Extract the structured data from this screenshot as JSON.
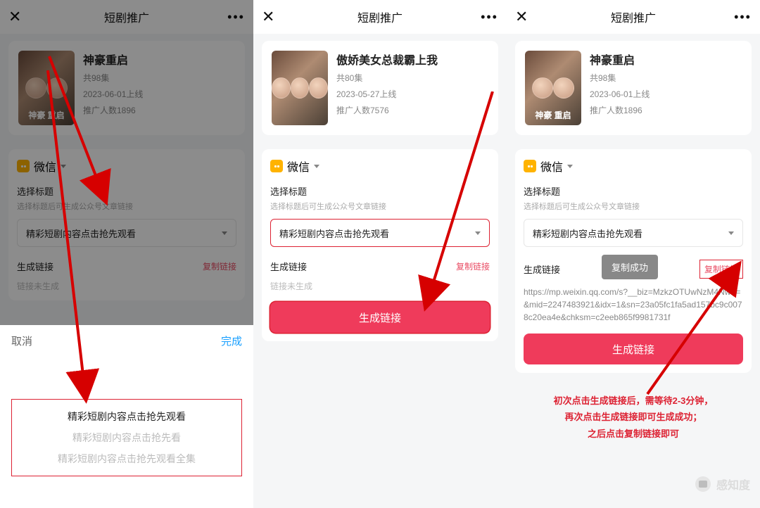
{
  "header_title": "短剧推广",
  "panes": [
    {
      "drama": {
        "title": "神豪重启",
        "eps": "共98集",
        "date": "2023-06-01上线",
        "promo": "推广人数1896"
      },
      "select_value": "精彩短剧内容点击抢先观看",
      "link_status": "链接未生成",
      "sheet": {
        "cancel": "取消",
        "done": "完成",
        "options": [
          "精彩短剧内容点击抢先观看",
          "精彩短剧内容点击抢先看",
          "精彩短剧内容点击抢先观看全集"
        ],
        "selected": 0
      }
    },
    {
      "drama": {
        "title": "傲娇美女总裁霸上我",
        "eps": "共80集",
        "date": "2023-05-27上线",
        "promo": "推广人数7576"
      },
      "select_value": "精彩短剧内容点击抢先观看",
      "link_status": "链接未生成"
    },
    {
      "drama": {
        "title": "神豪重启",
        "eps": "共98集",
        "date": "2023-06-01上线",
        "promo": "推广人数1896"
      },
      "select_value": "精彩短剧内容点击抢先观看",
      "link_url": "https://mp.weixin.qq.com/s?__biz=MzkzOTUwNzM4Nw==&mid=2247483921&idx=1&sn=23a05fc1fa5ad157bc9c0078c20ea4e&chksm=c2eeb865f9981731f",
      "toast": "复制成功",
      "note_lines": [
        "初次点击生成链接后，需等待2-3分钟，",
        "再次点击生成链接即可生成成功；",
        "之后点击复制链接即可"
      ]
    }
  ],
  "labels": {
    "wechat": "微信",
    "select_title": "选择标题",
    "select_hint": "选择标题后可生成公众号文章链接",
    "gen_title": "生成链接",
    "copy_link": "复制链接",
    "gen_btn": "生成链接"
  },
  "watermark": "感知度"
}
